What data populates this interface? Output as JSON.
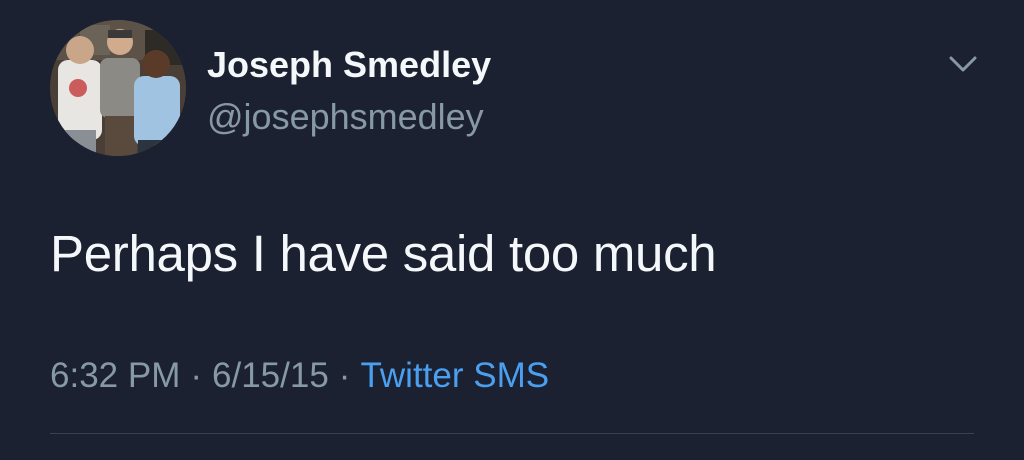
{
  "user": {
    "display_name": "Joseph Smedley",
    "handle": "@josephsmedley",
    "avatar_icon": "profile-photo"
  },
  "tweet": {
    "text": "Perhaps I have said too much",
    "time": "6:32 PM",
    "date": "6/15/15",
    "separator": "·",
    "source": "Twitter SMS"
  },
  "colors": {
    "background": "#1b2130",
    "primary_text": "#f5f8fa",
    "secondary_text": "#8899a6",
    "link": "#4a9ff0",
    "divider": "#38444d"
  },
  "icons": {
    "menu": "chevron-down-icon"
  }
}
